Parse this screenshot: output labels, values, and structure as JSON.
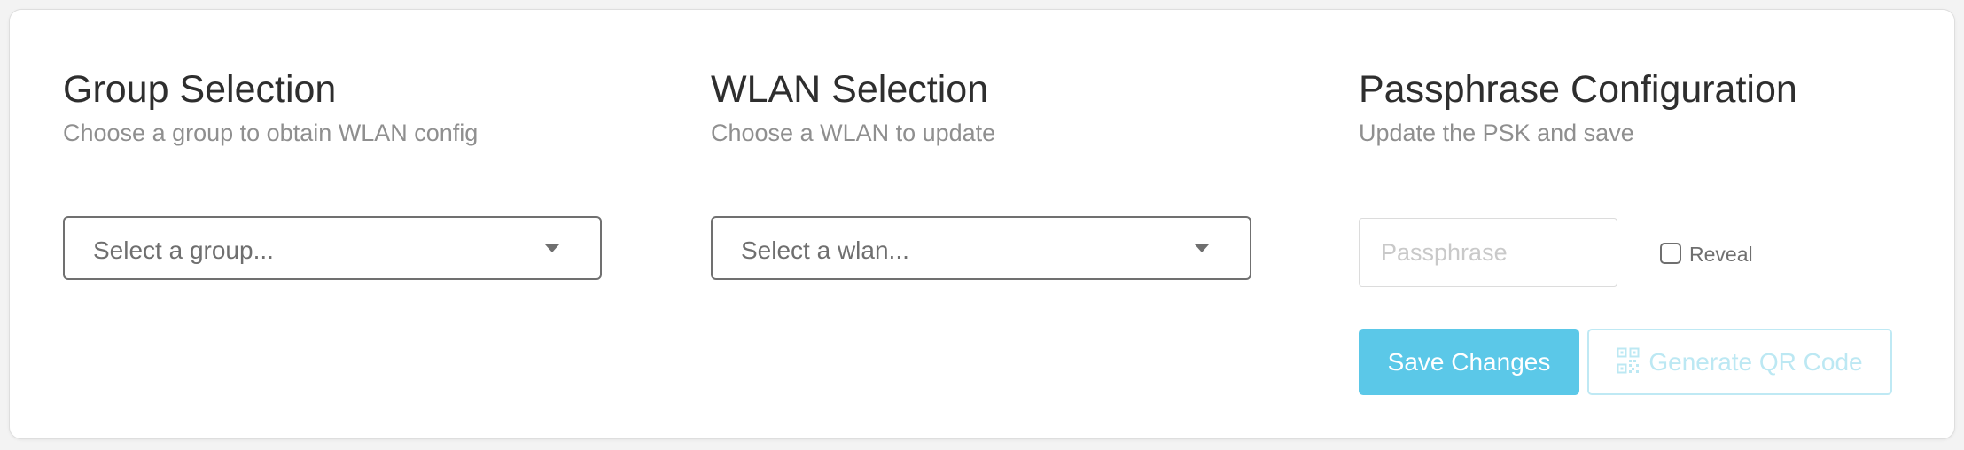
{
  "group_selection": {
    "title": "Group Selection",
    "subtitle": "Choose a group to obtain WLAN config",
    "select_placeholder": "Select a group..."
  },
  "wlan_selection": {
    "title": "WLAN Selection",
    "subtitle": "Choose a WLAN to update",
    "select_placeholder": "Select a wlan..."
  },
  "passphrase_configuration": {
    "title": "Passphrase Configuration",
    "subtitle": "Update the PSK and save",
    "input_placeholder": "Passphrase",
    "input_value": "",
    "reveal_label": "Reveal",
    "reveal_checked": false,
    "save_label": "Save Changes",
    "qr_label": "Generate QR Code",
    "qr_icon": "qr-code-icon"
  },
  "colors": {
    "primary": "#5bc8e8",
    "primary_disabled": "#bce8f3",
    "title_text": "#2e2e2e",
    "subtitle_text": "#8f8f8f"
  }
}
